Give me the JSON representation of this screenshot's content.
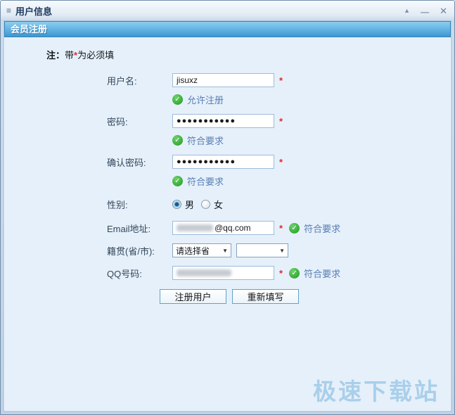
{
  "window": {
    "title": "用户信息",
    "menu_icon": "≡",
    "controls": {
      "collapse": "▲",
      "minimize": "—",
      "close": "✕"
    }
  },
  "header": {
    "title": "会员注册"
  },
  "note": {
    "label": "注：",
    "before": "带",
    "star": "*",
    "after": "为必须填"
  },
  "form": {
    "username": {
      "label": "用户名:",
      "value": "jisuxz",
      "required": "*",
      "status": "允许注册"
    },
    "password": {
      "label": "密码:",
      "value": "●●●●●●●●●●●",
      "required": "*",
      "status": "符合要求"
    },
    "confirm_password": {
      "label": "确认密码:",
      "value": "●●●●●●●●●●●",
      "required": "*",
      "status": "符合要求"
    },
    "gender": {
      "label": "性别:",
      "options": [
        {
          "label": "男",
          "selected": true
        },
        {
          "label": "女",
          "selected": false
        }
      ]
    },
    "email": {
      "label": "Email地址:",
      "masked": true,
      "visible_suffix": "@qq.com",
      "required": "*",
      "status": "符合要求"
    },
    "region": {
      "label": "籍贯(省/市):",
      "province_placeholder": "请选择省",
      "city_value": ""
    },
    "qq": {
      "label": "QQ号码:",
      "masked": true,
      "required": "*",
      "status": "符合要求"
    }
  },
  "buttons": {
    "register": "注册用户",
    "refill": "重新填写"
  },
  "status_icon": "✓",
  "watermark": "极速下载站",
  "colors": {
    "header_blue": "#3D97D0",
    "status_text_blue": "#587FB4",
    "required_red": "#E02B2B",
    "success_green": "#34AC34",
    "watermark_blue": "#A9CFEA"
  }
}
